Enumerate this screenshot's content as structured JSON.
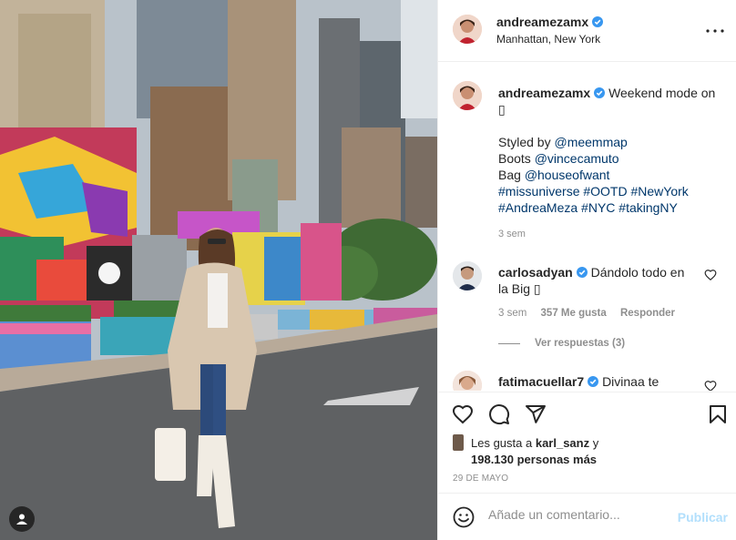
{
  "post": {
    "author": "andreamezamx",
    "location": "Manhattan, New York",
    "photo_alt": "Woman in beige coat and white boots standing on a city street with colorful graffiti walls and skyscrapers"
  },
  "caption": {
    "username": "andreamezamx",
    "first_line": "Weekend mode on",
    "emoji_line": "▯",
    "styled_by_prefix": "Styled by ",
    "styled_by": "@meemmap",
    "boots_prefix": "Boots ",
    "boots": "@vincecamuto",
    "bag_prefix": "Bag ",
    "bag": "@houseofwant",
    "hashtags_line1": "#missuniverse #OOTD #NewYork",
    "hashtags_line2": "#AndreaMeza #NYC #takingNY",
    "time": "3 sem"
  },
  "comments": [
    {
      "username": "carlosadyan",
      "text": "Dándolo todo en",
      "text_line2": "la Big ▯",
      "time": "3 sem",
      "likes": "357 Me gusta",
      "reply_label": "Responder",
      "view_replies": "Ver respuestas (3)"
    },
    {
      "username": "fatimacuellar7",
      "text": "Divinaa te"
    }
  ],
  "likes": {
    "prefix": "Les gusta a",
    "user": "karl_sanz",
    "connector": "y",
    "count": "198.130 personas más"
  },
  "date": "29 DE MAYO",
  "add_comment": {
    "placeholder": "Añade un comentario...",
    "publish_label": "Publicar"
  },
  "colors": {
    "link": "#00376b",
    "verified": "#3897f0",
    "muted": "#8e8e8e",
    "publish_disabled": "#b2dffc"
  },
  "icons": {
    "emoji": "smiley-icon",
    "like": "heart-icon",
    "comment": "comment-icon",
    "share": "paper-plane-icon",
    "save": "bookmark-icon",
    "more": "more-dots-icon",
    "verified": "verified-badge-icon",
    "tag": "user-tag-icon"
  }
}
